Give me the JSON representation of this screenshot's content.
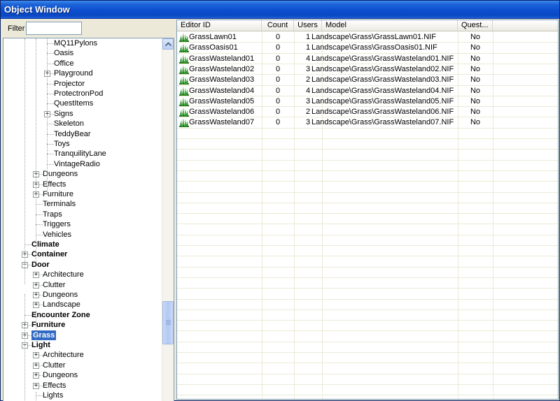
{
  "window": {
    "title": "Object Window"
  },
  "filter": {
    "label": "Filter",
    "value": ""
  },
  "tree": {
    "nodes": [
      {
        "label": "MQ11Pylons",
        "level": 3,
        "expander": false,
        "bold": false
      },
      {
        "label": "Oasis",
        "level": 3,
        "expander": false,
        "bold": false
      },
      {
        "label": "Office",
        "level": 3,
        "expander": false,
        "bold": false
      },
      {
        "label": "Playground",
        "level": 3,
        "expander": true,
        "bold": false
      },
      {
        "label": "Projector",
        "level": 3,
        "expander": false,
        "bold": false
      },
      {
        "label": "ProtectronPod",
        "level": 3,
        "expander": false,
        "bold": false
      },
      {
        "label": "QuestItems",
        "level": 3,
        "expander": false,
        "bold": false
      },
      {
        "label": "Signs",
        "level": 3,
        "expander": true,
        "bold": false
      },
      {
        "label": "Skeleton",
        "level": 3,
        "expander": false,
        "bold": false
      },
      {
        "label": "TeddyBear",
        "level": 3,
        "expander": false,
        "bold": false
      },
      {
        "label": "Toys",
        "level": 3,
        "expander": false,
        "bold": false
      },
      {
        "label": "TranquilityLane",
        "level": 3,
        "expander": false,
        "bold": false
      },
      {
        "label": "VintageRadio",
        "level": 3,
        "expander": false,
        "bold": false
      },
      {
        "label": "Dungeons",
        "level": 2,
        "expander": true,
        "bold": false
      },
      {
        "label": "Effects",
        "level": 2,
        "expander": true,
        "bold": false
      },
      {
        "label": "Furniture",
        "level": 2,
        "expander": true,
        "bold": false
      },
      {
        "label": "Terminals",
        "level": 2,
        "expander": false,
        "bold": false
      },
      {
        "label": "Traps",
        "level": 2,
        "expander": false,
        "bold": false
      },
      {
        "label": "Triggers",
        "level": 2,
        "expander": false,
        "bold": false
      },
      {
        "label": "Vehicles",
        "level": 2,
        "expander": false,
        "bold": false
      },
      {
        "label": "Climate",
        "level": 1,
        "expander": false,
        "bold": true
      },
      {
        "label": "Container",
        "level": 1,
        "expander": true,
        "bold": true
      },
      {
        "label": "Door",
        "level": 1,
        "expander": true,
        "bold": true,
        "open": true
      },
      {
        "label": "Architecture",
        "level": 2,
        "expander": true,
        "bold": false
      },
      {
        "label": "Clutter",
        "level": 2,
        "expander": true,
        "bold": false
      },
      {
        "label": "Dungeons",
        "level": 2,
        "expander": true,
        "bold": false
      },
      {
        "label": "Landscape",
        "level": 2,
        "expander": true,
        "bold": false
      },
      {
        "label": "Encounter Zone",
        "level": 1,
        "expander": false,
        "bold": true
      },
      {
        "label": "Furniture",
        "level": 1,
        "expander": true,
        "bold": true
      },
      {
        "label": "Grass",
        "level": 1,
        "expander": true,
        "bold": true,
        "selected": true
      },
      {
        "label": "Light",
        "level": 1,
        "expander": true,
        "bold": true,
        "open": true
      },
      {
        "label": "Architecture",
        "level": 2,
        "expander": true,
        "bold": false
      },
      {
        "label": "Clutter",
        "level": 2,
        "expander": true,
        "bold": false
      },
      {
        "label": "Dungeons",
        "level": 2,
        "expander": true,
        "bold": false
      },
      {
        "label": "Effects",
        "level": 2,
        "expander": true,
        "bold": false
      },
      {
        "label": "Lights",
        "level": 2,
        "expander": false,
        "bold": false
      }
    ]
  },
  "table": {
    "columns": [
      "Editor ID",
      "Count",
      "Users",
      "Model",
      "Quest..."
    ],
    "rows": [
      {
        "id": "GrassLawn01",
        "count": "0",
        "users": "1",
        "model": "Landscape\\Grass\\GrassLawn01.NIF",
        "quest": "No"
      },
      {
        "id": "GrassOasis01",
        "count": "0",
        "users": "1",
        "model": "Landscape\\Grass\\GrassOasis01.NIF",
        "quest": "No"
      },
      {
        "id": "GrassWasteland01",
        "count": "0",
        "users": "4",
        "model": "Landscape\\Grass\\GrassWasteland01.NIF",
        "quest": "No"
      },
      {
        "id": "GrassWasteland02",
        "count": "0",
        "users": "3",
        "model": "Landscape\\Grass\\GrassWasteland02.NIF",
        "quest": "No"
      },
      {
        "id": "GrassWasteland03",
        "count": "0",
        "users": "2",
        "model": "Landscape\\Grass\\GrassWasteland03.NIF",
        "quest": "No"
      },
      {
        "id": "GrassWasteland04",
        "count": "0",
        "users": "4",
        "model": "Landscape\\Grass\\GrassWasteland04.NIF",
        "quest": "No"
      },
      {
        "id": "GrassWasteland05",
        "count": "0",
        "users": "3",
        "model": "Landscape\\Grass\\GrassWasteland05.NIF",
        "quest": "No"
      },
      {
        "id": "GrassWasteland06",
        "count": "0",
        "users": "2",
        "model": "Landscape\\Grass\\GrassWasteland06.NIF",
        "quest": "No"
      },
      {
        "id": "GrassWasteland07",
        "count": "0",
        "users": "3",
        "model": "Landscape\\Grass\\GrassWasteland07.NIF",
        "quest": "No"
      }
    ]
  },
  "icons": {
    "row_icon": "grass-icon",
    "scroll_up": "scroll-up-arrow-icon",
    "scroll_down": "scroll-down-arrow-icon",
    "expander": "tree-expander-icon"
  }
}
